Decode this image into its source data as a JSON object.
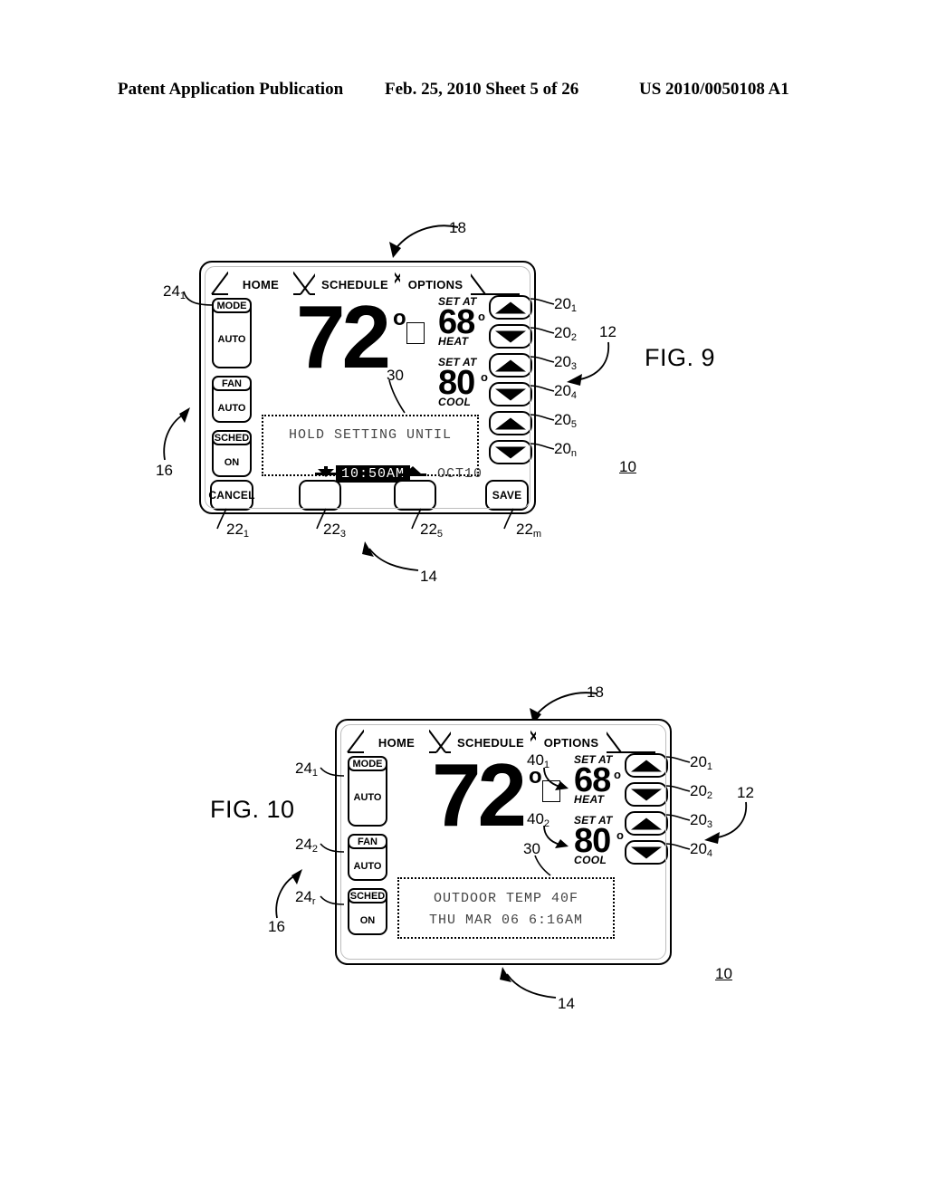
{
  "page_header": {
    "publication": "Patent Application Publication",
    "date_sheet": "Feb. 25, 2010  Sheet 5 of 26",
    "patent_number": "US 2010/0050108 A1"
  },
  "figures": [
    {
      "label": "FIG. 9",
      "device_ref": "10",
      "tabs": [
        {
          "label": "HOME"
        },
        {
          "label": "SCHEDULE"
        },
        {
          "label": "OPTIONS"
        }
      ],
      "tab_row_ref": "18",
      "display_ref": "30",
      "housing_ref": "14",
      "side_col_ref": "16",
      "side_buttons": [
        {
          "cap": "MODE",
          "value": "AUTO",
          "ref": "24",
          "sub": "1"
        },
        {
          "cap": "FAN",
          "value": "AUTO"
        },
        {
          "cap": "SCHED",
          "value": "ON"
        }
      ],
      "temperature": {
        "value": "72",
        "degree": "o"
      },
      "setpoints": [
        {
          "set_at": "SET AT",
          "value": "68",
          "degree": "o",
          "mode": "HEAT"
        },
        {
          "set_at": "SET AT",
          "value": "80",
          "degree": "o",
          "mode": "COOL"
        }
      ],
      "arrow_buttons": [
        {
          "dir": "up",
          "ref": "20",
          "sub": "1"
        },
        {
          "dir": "down",
          "ref": "20",
          "sub": "2"
        },
        {
          "dir": "up",
          "ref": "20",
          "sub": "3"
        },
        {
          "dir": "down",
          "ref": "20",
          "sub": "4"
        },
        {
          "dir": "up",
          "ref": "20",
          "sub": "5"
        },
        {
          "dir": "down",
          "ref": "20",
          "sub": "n"
        }
      ],
      "arrow_col_ref": "12",
      "lcd": {
        "line1": "HOLD SETTING UNTIL",
        "line2_highlight": "10:50AM",
        "line2_plain": "OCT10"
      },
      "bottom_buttons": [
        {
          "label": "CANCEL",
          "ref": "22",
          "sub": "1"
        },
        {
          "label": "",
          "ref": "22",
          "sub": "3"
        },
        {
          "label": "",
          "ref": "22",
          "sub": "5"
        },
        {
          "label": "SAVE",
          "ref": "22",
          "sub": "m"
        }
      ]
    },
    {
      "label": "FIG. 10",
      "device_ref": "10",
      "tabs": [
        {
          "label": "HOME"
        },
        {
          "label": "SCHEDULE"
        },
        {
          "label": "OPTIONS"
        }
      ],
      "tab_row_ref": "18",
      "display_ref": "30",
      "housing_ref": "14",
      "side_col_ref": "16",
      "side_buttons": [
        {
          "cap": "MODE",
          "value": "AUTO",
          "ref": "24",
          "sub": "1"
        },
        {
          "cap": "FAN",
          "value": "AUTO",
          "ref": "24",
          "sub": "2"
        },
        {
          "cap": "SCHED",
          "value": "ON",
          "ref": "24",
          "sub": "r"
        }
      ],
      "temperature": {
        "value": "72",
        "degree": "o"
      },
      "setpoints": [
        {
          "set_at": "SET AT",
          "value": "68",
          "degree": "o",
          "mode": "HEAT",
          "ref": "40",
          "sub": "1"
        },
        {
          "set_at": "SET AT",
          "value": "80",
          "degree": "o",
          "mode": "COOL",
          "ref": "40",
          "sub": "2"
        }
      ],
      "arrow_buttons": [
        {
          "dir": "up",
          "ref": "20",
          "sub": "1"
        },
        {
          "dir": "down",
          "ref": "20",
          "sub": "2"
        },
        {
          "dir": "up",
          "ref": "20",
          "sub": "3"
        },
        {
          "dir": "down",
          "ref": "20",
          "sub": "4"
        }
      ],
      "arrow_col_ref": "12",
      "lcd": {
        "line1": "OUTDOOR TEMP 40F",
        "line2": "THU MAR 06 6:16AM"
      }
    }
  ]
}
